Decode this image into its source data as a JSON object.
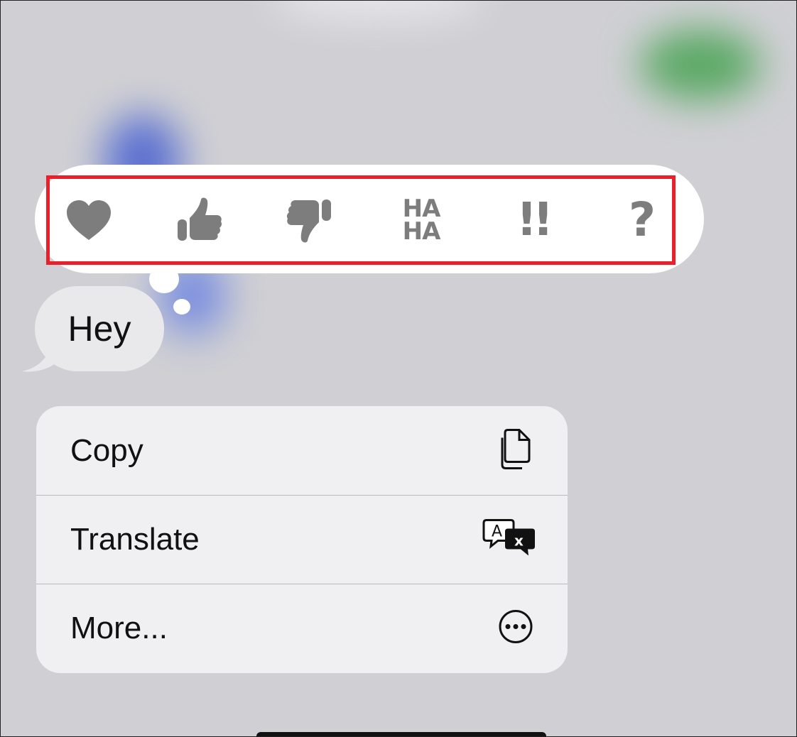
{
  "reactions": [
    {
      "name": "heart-reaction",
      "icon": "heart-icon"
    },
    {
      "name": "thumbs-up-reaction",
      "icon": "thumbs-up-icon"
    },
    {
      "name": "thumbs-down-reaction",
      "icon": "thumbs-down-icon"
    },
    {
      "name": "haha-reaction",
      "icon": "haha-icon",
      "line1": "HA",
      "line2": "HA"
    },
    {
      "name": "emphasize-reaction",
      "icon": "double-exclamation-icon",
      "glyph": "!!"
    },
    {
      "name": "question-reaction",
      "icon": "question-mark-icon",
      "glyph": "?"
    }
  ],
  "message": {
    "text": "Hey"
  },
  "menu": {
    "items": [
      {
        "label": "Copy",
        "icon": "copy-icon"
      },
      {
        "label": "Translate",
        "icon": "translate-icon"
      },
      {
        "label": "More...",
        "icon": "more-ellipsis-icon"
      }
    ]
  },
  "colors": {
    "highlight": "#ea1f2c",
    "reaction_gray": "#7d7d7d",
    "menu_bg": "#f0f0f2",
    "bubble_bg": "#e9e9eb"
  }
}
